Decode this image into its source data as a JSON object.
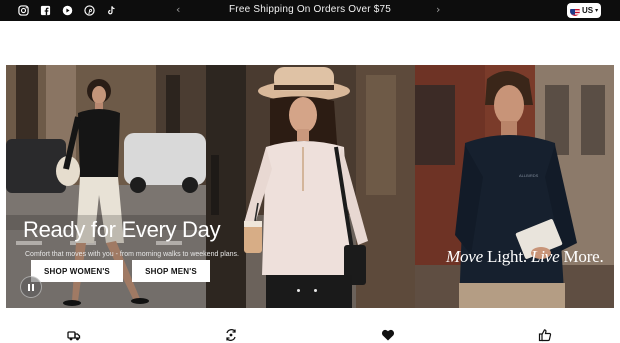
{
  "topbar": {
    "announcement": "Free Shipping On Orders Over $75",
    "social_icons": [
      "instagram-icon",
      "facebook-icon",
      "youtube-icon",
      "pinterest-icon",
      "tiktok-icon"
    ],
    "prev_icon": "chevron-left-icon",
    "next_icon": "chevron-right-icon",
    "prev_glyph": "‹",
    "next_glyph": "›",
    "locale": {
      "code": "US",
      "flag_icon": "us-flag-icon",
      "chevron_glyph": "▾"
    },
    "background": "#0d0d0d"
  },
  "hero": {
    "title": "Ready for Every Day",
    "subtitle": "Comfort that moves with you - from morning walks to weekend plans.",
    "shop_women_label": "SHOP WOMEN'S",
    "shop_men_label": "SHOP MEN'S",
    "pause_icon": "pause-icon",
    "slide_count": 2,
    "tagline_part1": "Move",
    "tagline_part2": "Light.",
    "tagline_part3": "Live",
    "tagline_part4": "More."
  },
  "features": {
    "icons": [
      "delivery-truck-icon",
      "returns-exchange-icon",
      "heart-icon",
      "thumbs-up-icon"
    ]
  },
  "colors": {
    "topbar": "#0d0d0d",
    "button_bg": "#ffffff",
    "button_text": "#111111"
  }
}
